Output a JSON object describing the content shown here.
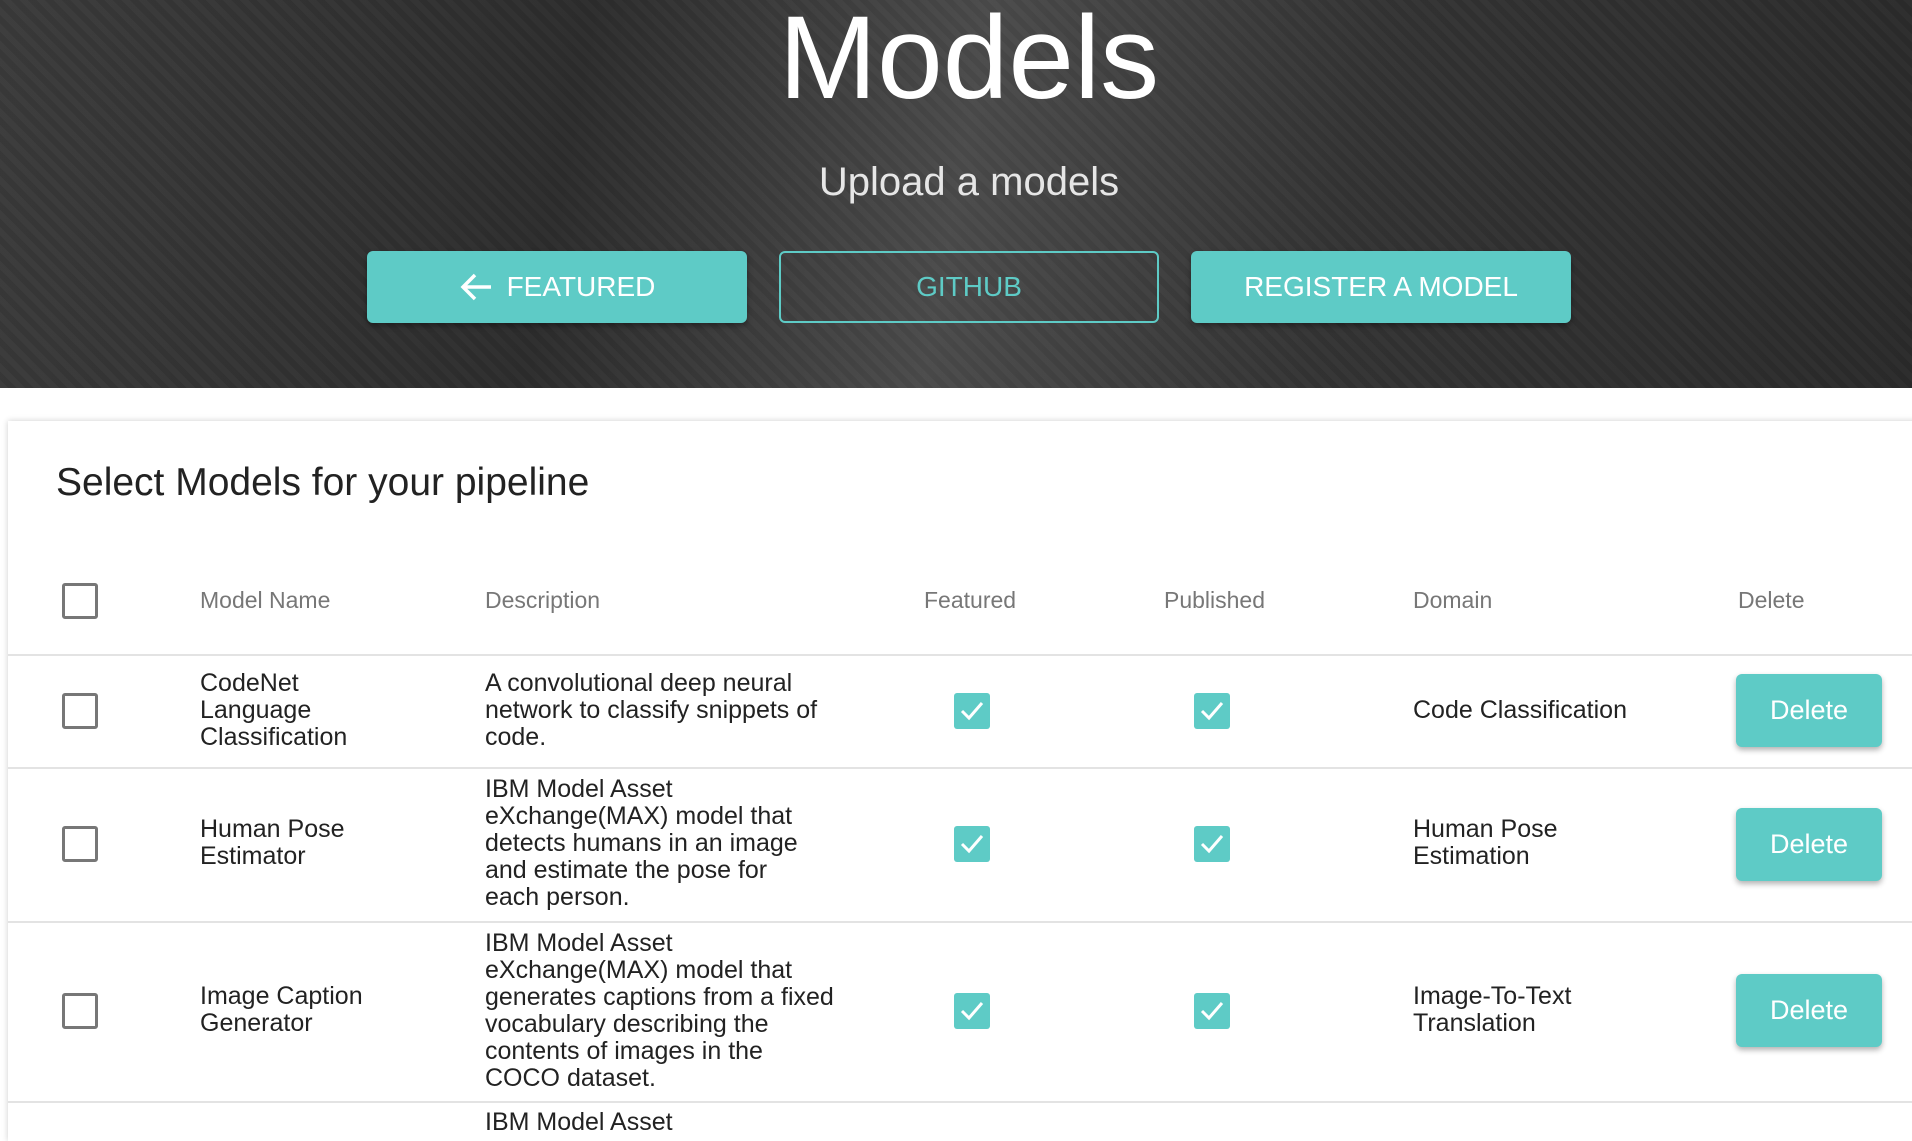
{
  "hero": {
    "title": "Models",
    "subtitle": "Upload a models",
    "buttons": {
      "featured": "FEATURED",
      "github": "GITHUB",
      "register": "REGISTER A MODEL"
    }
  },
  "card": {
    "title": "Select Models for your pipeline",
    "columns": [
      "Model Name",
      "Description",
      "Featured",
      "Published",
      "Domain",
      "Delete"
    ],
    "rows": [
      {
        "name": "CodeNet Language Classification",
        "description": "A convolutional deep neural network to classify snippets of code.",
        "featured": true,
        "published": true,
        "domain": "Code Classification",
        "delete": "Delete"
      },
      {
        "name": "Human Pose Estimator",
        "description": "IBM Model Asset eXchange(MAX) model that detects humans in an image and estimate the pose for each person.",
        "featured": true,
        "published": true,
        "domain": "Human Pose Estimation",
        "delete": "Delete"
      },
      {
        "name": "Image Caption Generator",
        "description": "IBM Model Asset eXchange(MAX) model that generates captions from a fixed vocabulary describing the contents of images in the COCO dataset.",
        "featured": true,
        "published": true,
        "domain": "Image-To-Text Translation",
        "delete": "Delete"
      },
      {
        "description": "IBM Model Asset"
      }
    ]
  },
  "colors": {
    "accent": "#5ecbc6"
  }
}
